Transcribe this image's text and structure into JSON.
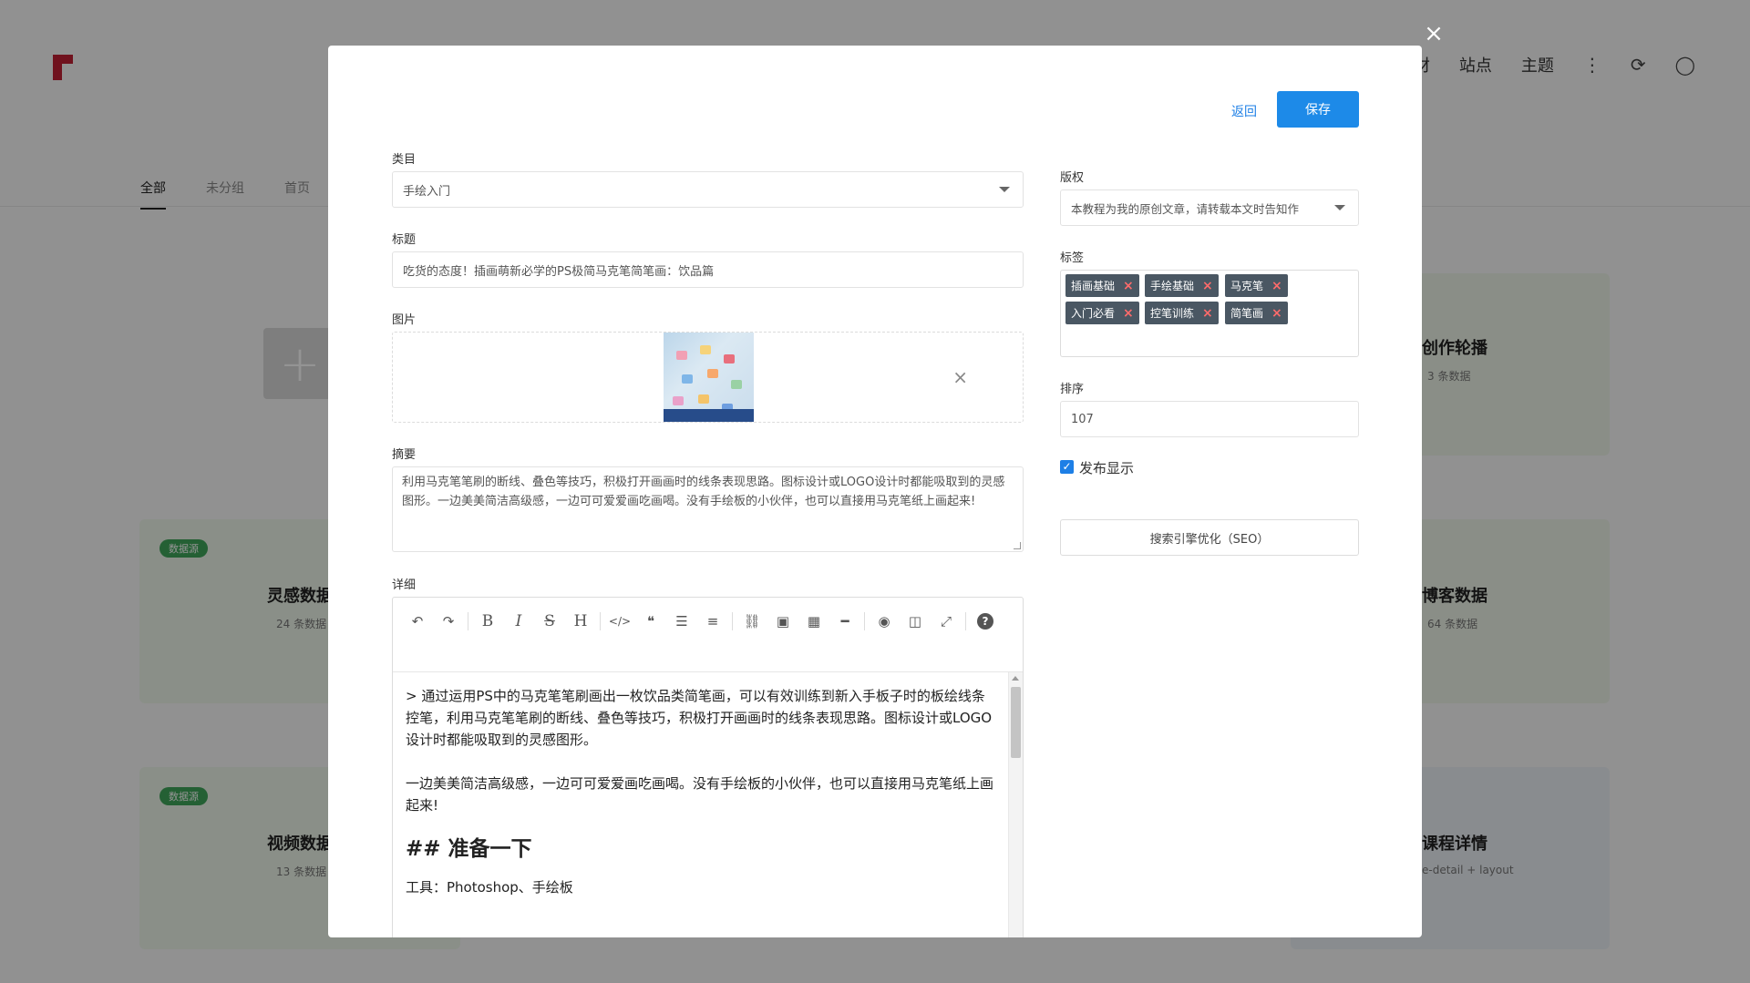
{
  "background": {
    "nav": [
      "素材",
      "站点",
      "主题"
    ],
    "tabs": [
      "全部",
      "未分组",
      "首页"
    ],
    "cards": [
      {
        "badge": "数据源",
        "title": "灵感数据",
        "sub": "24 条数据"
      },
      {
        "badge": "数据源",
        "title": "视频数据",
        "sub": "13 条数据"
      },
      {
        "title": "创作轮播",
        "sub": "3 条数据"
      },
      {
        "title": "博客数据",
        "sub": "64 条数据"
      },
      {
        "title": "课程详情",
        "sub": "e-detail + layout"
      }
    ]
  },
  "modal": {
    "back_label": "返回",
    "save_label": "保存",
    "category": {
      "label": "类目",
      "value": "手绘入门"
    },
    "title": {
      "label": "标题",
      "value": "吃货的态度！插画萌新必学的PS极简马克笔简笔画：饮品篇"
    },
    "image": {
      "label": "图片"
    },
    "summary": {
      "label": "摘要",
      "value": "利用马克笔笔刷的断线、叠色等技巧，积极打开画画时的线条表现思路。图标设计或LOGO设计时都能吸取到的灵感图形。一边美美简洁高级感，一边可可爱爱画吃画喝。没有手绘板的小伙伴，也可以直接用马克笔纸上画起来!"
    },
    "detail": {
      "label": "详细",
      "toolbar": [
        {
          "name": "undo-icon",
          "glyph": "↶"
        },
        {
          "name": "redo-icon",
          "glyph": "↷"
        },
        {
          "sep": true
        },
        {
          "name": "bold-icon",
          "glyph": "B",
          "serif": true
        },
        {
          "name": "italic-icon",
          "glyph": "I",
          "serif": true,
          "italic": true
        },
        {
          "name": "strikethrough-icon",
          "glyph": "S",
          "serif": true,
          "strike": true
        },
        {
          "name": "heading-icon",
          "glyph": "H",
          "serif": true
        },
        {
          "sep": true
        },
        {
          "name": "code-icon",
          "glyph": "</>"
        },
        {
          "name": "quote-icon",
          "glyph": "❝"
        },
        {
          "name": "bullet-list-icon",
          "glyph": "☰"
        },
        {
          "name": "numbered-list-icon",
          "glyph": "≡"
        },
        {
          "sep": true
        },
        {
          "name": "link-icon",
          "glyph": "⛓"
        },
        {
          "name": "image-icon",
          "glyph": "▣"
        },
        {
          "name": "table-icon",
          "glyph": "▦"
        },
        {
          "name": "horizontal-rule-icon",
          "glyph": "━"
        },
        {
          "sep": true
        },
        {
          "name": "preview-icon",
          "glyph": "◉"
        },
        {
          "name": "side-by-side-icon",
          "glyph": "◫"
        },
        {
          "name": "fullscreen-icon",
          "glyph": "⤢"
        },
        {
          "sep": true
        },
        {
          "name": "help-icon",
          "glyph": "?"
        }
      ],
      "paragraph1": "> 通过运用PS中的马克笔笔刷画出一枚饮品类简笔画，可以有效训练到新入手板子时的板绘线条控笔，利用马克笔笔刷的断线、叠色等技巧，积极打开画画时的线条表现思路。图标设计或LOGO设计时都能吸取到的灵感图形。",
      "paragraph2": "一边美美简洁高级感，一边可可爱爱画吃画喝。没有手绘板的小伙伴，也可以直接用马克笔纸上画起来!",
      "heading": "## 准备一下",
      "paragraph3": "工具：Photoshop、手绘板"
    },
    "copyright": {
      "label": "版权",
      "value": "本教程为我的原创文章，请转载本文时告知作"
    },
    "tags": {
      "label": "标签",
      "items": [
        "插画基础",
        "手绘基础",
        "马克笔",
        "入门必看",
        "控笔训练",
        "简笔画"
      ]
    },
    "sort": {
      "label": "排序",
      "value": "107"
    },
    "publish": {
      "label": "发布显示",
      "checked": true
    },
    "seo_label": "搜索引擎优化（SEO）"
  },
  "colors": {
    "primary": "#1d8ae8",
    "tag_bg": "#4a5763",
    "tag_remove": "#ff6b6b",
    "brand": "#c21f34"
  }
}
